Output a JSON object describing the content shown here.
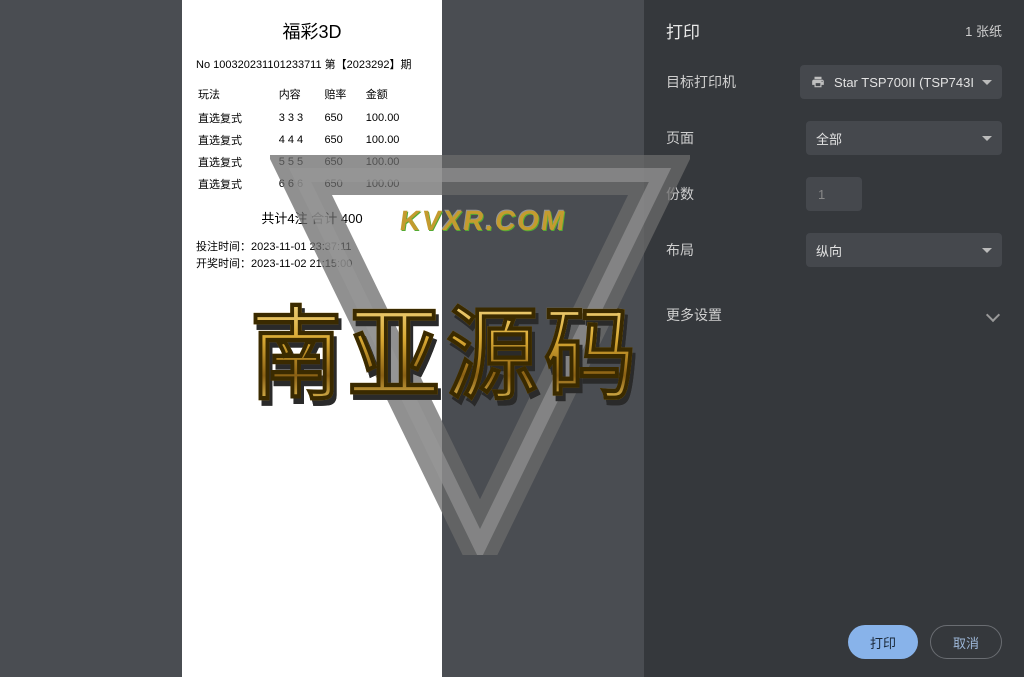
{
  "receipt": {
    "title": "福彩3D",
    "no_line": "No  100320231101233711  第【2023292】期",
    "headers": [
      "玩法",
      "内容",
      "赔率",
      "金额"
    ],
    "rows": [
      [
        "直选复式",
        "3 3 3",
        "650",
        "100.00"
      ],
      [
        "直选复式",
        "4 4 4",
        "650",
        "100.00"
      ],
      [
        "直选复式",
        "5 5 5",
        "650",
        "100.00"
      ],
      [
        "直选复式",
        "6 6 6",
        "650",
        "100.00"
      ]
    ],
    "total": "共计4注   合计 400",
    "bet_time_label": "投注时间：",
    "bet_time": "2023-11-01 23:37:11",
    "draw_time_label": "开奖时间：",
    "draw_time": "2023-11-02 21:15:00"
  },
  "panel": {
    "title": "打印",
    "sheet_count": "1 张纸",
    "printer_label": "目标打印机",
    "printer_value": "Star TSP700II (TSP743I",
    "pages_label": "页面",
    "pages_value": "全部",
    "copies_label": "份数",
    "copies_value": "1",
    "layout_label": "布局",
    "layout_value": "纵向",
    "more_settings": "更多设置",
    "print_btn": "打印",
    "cancel_btn": "取消"
  },
  "watermark": {
    "url": "KVXR.COM",
    "main": "南亚源码"
  }
}
